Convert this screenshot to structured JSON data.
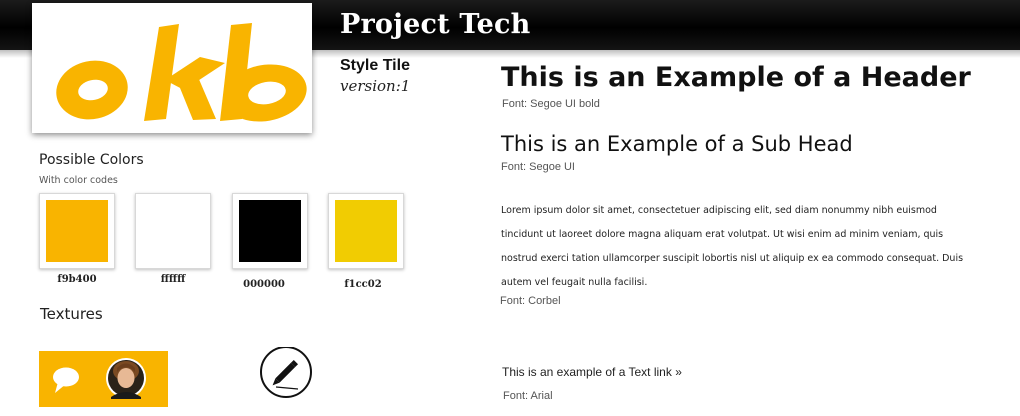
{
  "header": {
    "title": "Project Tech"
  },
  "logo": {
    "text": "okb",
    "color": "#f9b400"
  },
  "style_tile": {
    "label": "Style Tile",
    "version": "version:1"
  },
  "colors_section": {
    "heading": "Possible Colors",
    "subheading": "With color codes",
    "swatches": [
      {
        "code": "f9b400",
        "hex": "#f9b400"
      },
      {
        "code": "ffffff",
        "hex": "#ffffff"
      },
      {
        "code": "000000",
        "hex": "#000000"
      },
      {
        "code": "f1cc02",
        "hex": "#f1cc02"
      }
    ]
  },
  "textures": {
    "heading": "Textures",
    "icons": [
      "speech-bubble-icon",
      "avatar",
      "pencil-icon"
    ]
  },
  "typography": {
    "header_example": "This is an Example of a Header",
    "header_font": "Font: Segoe UI bold",
    "subhead_example": "This is an Example of a Sub Head",
    "subhead_font": "Font: Segoe UI",
    "body_text": "Lorem ipsum dolor sit amet, consectetuer adipiscing elit, sed diam nonummy nibh euismod tincidunt ut laoreet dolore magna aliquam erat volutpat. Ut wisi enim ad minim veniam, quis nostrud exerci tation ullamcorper suscipit lobortis nisl ut aliquip ex ea commodo consequat. Duis autem vel feugait nulla facilisi.",
    "body_font": "Font: Corbel",
    "link_text": "This is an example of a Text link »",
    "link_font": "Font: Arial"
  }
}
